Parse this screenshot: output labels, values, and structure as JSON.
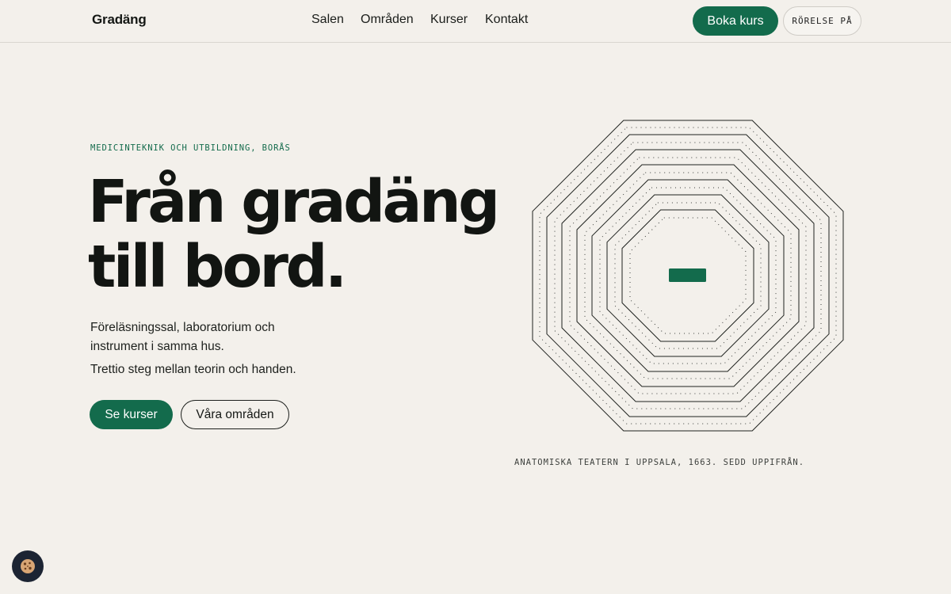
{
  "header": {
    "logo": "Gradäng",
    "nav": [
      "Salen",
      "Områden",
      "Kurser",
      "Kontakt"
    ],
    "book_label": "Boka kurs",
    "motion_label": "RÖRELSE PÅ"
  },
  "hero": {
    "eyebrow": "MEDICINTEKNIK OCH UTBILDNING, BORÅS",
    "headline_line1": "Från gradäng",
    "headline_line2": "till bord.",
    "lead": "Föreläsningssal, laboratorium och instrument i samma hus.",
    "lead2": "Trettio steg mellan teorin och handen.",
    "primary_button": "Se kurser",
    "secondary_button": "Våra områden",
    "caption": "ANATOMISKA TEATERN I UPPSALA, 1663. SEDD UPPIFRÅN."
  },
  "colors": {
    "background": "#f3f0eb",
    "accent": "#136b4c",
    "text": "#141714"
  },
  "cookie": {
    "icon": "cookie-icon"
  }
}
